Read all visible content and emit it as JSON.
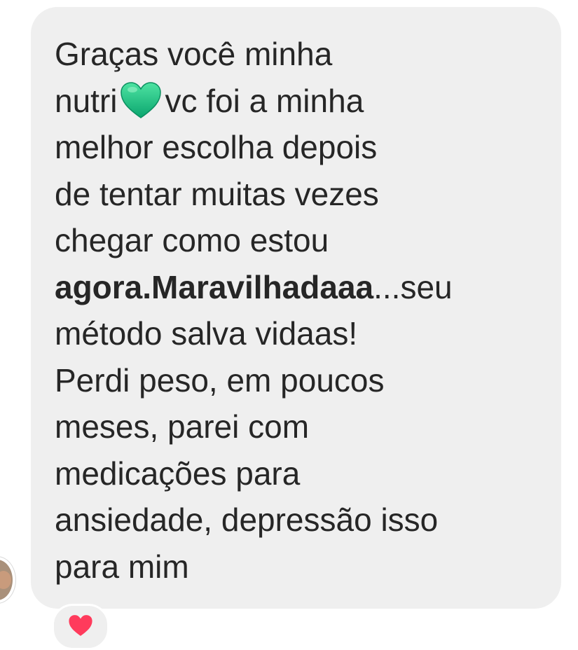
{
  "message": {
    "lines": [
      "Graças você minha",
      "nutri",
      "vc foi a minha",
      "melhor escolha depois",
      "de tentar muitas vezes",
      "chegar como estou",
      "agora.Maravilhadaaa",
      "...seu",
      "método salva vidaas!",
      "Perdi peso, em poucos",
      "meses, parei com",
      "medicações para",
      "ansiedade, depressão isso",
      "para mim"
    ],
    "inline_emoji": "green-heart-icon"
  },
  "reaction": {
    "emoji": "red-heart-icon"
  },
  "colors": {
    "bubble": "#efefef",
    "text": "#262626",
    "heart_green": "#19c48a",
    "heart_red": "#ff3b5c"
  }
}
